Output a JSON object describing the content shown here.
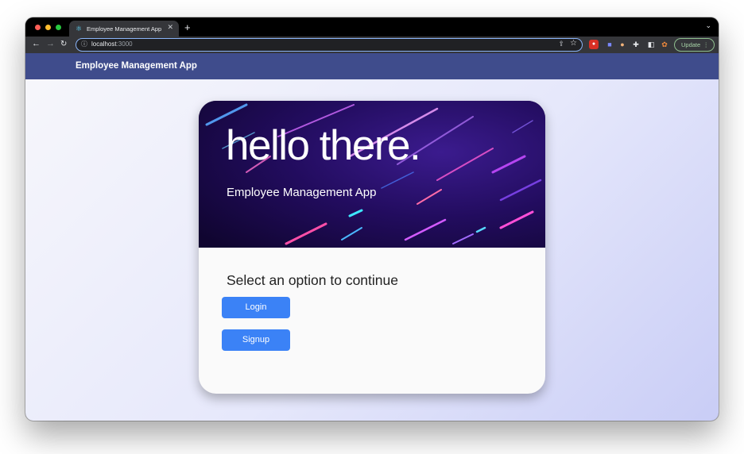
{
  "browser": {
    "tab_title": "Employee Management App",
    "new_tab_label": "+",
    "url_host": "localhost",
    "url_port": ":3000",
    "update_label": "Update",
    "icons": [
      "react-favicon-icon",
      "back-icon",
      "forward-icon",
      "reload-icon",
      "info-icon",
      "share-icon",
      "star-icon",
      "extension-icon",
      "side-panel-icon",
      "menu-icon"
    ]
  },
  "appbar": {
    "brand": "Employee Management App",
    "color": "#3f4c8c"
  },
  "hero": {
    "title": "hello there.",
    "subtitle": "Employee Management App"
  },
  "main": {
    "prompt": "Select an option to continue",
    "login_label": "Login",
    "signup_label": "Signup",
    "button_color": "#3b82f6"
  }
}
